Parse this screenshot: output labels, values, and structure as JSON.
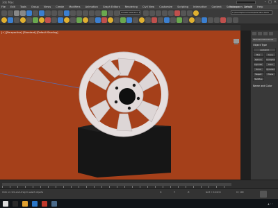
{
  "window": {
    "title": "3ds Max",
    "search_value": "",
    "controls": [
      "–",
      "□",
      "✕"
    ]
  },
  "menu": [
    "File",
    "Edit",
    "Tools",
    "Group",
    "Views",
    "Create",
    "Modifiers",
    "Animation",
    "Graph Editors",
    "Rendering",
    "Civil View",
    "Customize",
    "Scripting",
    "Interactive",
    "Content",
    "Substance",
    "Arnold",
    "Help"
  ],
  "workspace_label": "Workspaces: Default",
  "toolbar": {
    "selection_set": "Create Selection Set",
    "project_path": "C:\\Users\\Documents\\3ds Max 2023"
  },
  "viewport": {
    "label": "[+] [Perspective] [Standard] [Default Shading]"
  },
  "command_panel": {
    "dropdown": "Standard Primitives",
    "object_type_title": "Object Type",
    "autogrid": "AutoGrid",
    "buttons": [
      "Box",
      "Cone",
      "Sphere",
      "GeoSphere",
      "Cylinder",
      "Tube",
      "Torus",
      "Pyramid",
      "Teapot",
      "Plane",
      "TextPlus"
    ],
    "name_color_title": "Name and Color"
  },
  "status": {
    "text": "Click or click-and-drag to select objects",
    "x": "X:",
    "y": "Y:",
    "z": "Z:",
    "grid": "Grid = 10.0cm",
    "time": "0 / 100"
  },
  "taskbar": {
    "clock": ""
  },
  "colors": {
    "viewport_bg": "#a5401a",
    "rim": "#e7e2e2",
    "pedestal": "#141414"
  }
}
